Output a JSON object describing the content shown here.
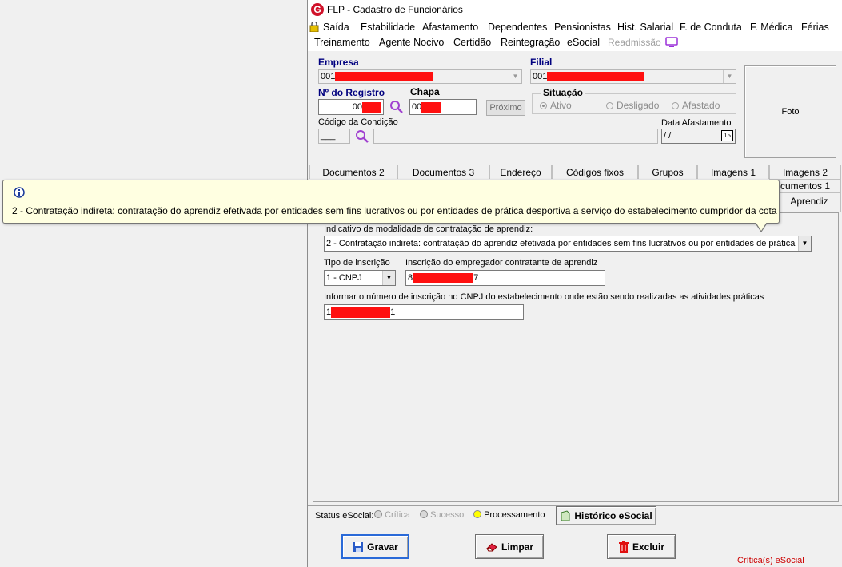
{
  "window": {
    "title": "FLP - Cadastro de Funcionários",
    "logo_letter": "G"
  },
  "menu": {
    "row1": [
      "Saída",
      "Estabilidade",
      "Afastamento",
      "Dependentes",
      "Pensionistas",
      "Hist. Salarial",
      "F. de Conduta",
      "F. Médica",
      "Férias"
    ],
    "row2": [
      "Treinamento",
      "Agente Nocivo",
      "Certidão",
      "Reintegração",
      "eSocial",
      "Readmissão"
    ]
  },
  "form": {
    "empresa_label": "Empresa",
    "empresa_value": "001",
    "filial_label": "Filial",
    "filial_value": "001",
    "registro_label": "Nº do Registro",
    "registro_value": "00",
    "chapa_label": "Chapa",
    "chapa_value": "00",
    "proximo_label": "Próximo",
    "situacao_label": "Situação",
    "situacao_options": [
      "Ativo",
      "Desligado",
      "Afastado"
    ],
    "codigo_condicao_label": "Código da Condição",
    "codigo_condicao_value": "___",
    "data_afastamento_label": "Data Afastamento",
    "data_afastamento_value": " /  /",
    "calendar_label": "15",
    "foto_label": "Foto"
  },
  "tabs": {
    "row1": [
      "Documentos 2",
      "Documentos 3",
      "Endereço",
      "Códigos fixos",
      "Grupos",
      "Imagens 1",
      "Imagens 2"
    ],
    "row2_partial": "cumentos 1",
    "active": "Aprendiz"
  },
  "aprendiz": {
    "modalidade_label": "Indicativo de modalidade de contratação de aprendiz:",
    "modalidade_value": "2 - Contratação indireta: contratação do aprendiz efetivada por entidades sem fins lucrativos ou por entidades de prática desp",
    "tipo_inscricao_label": "Tipo de inscrição",
    "tipo_inscricao_value": "1 - CNPJ",
    "inscricao_empregador_label": "Inscrição do empregador contratante de aprendiz",
    "inscricao_empregador_prefix": "8",
    "inscricao_empregador_suffix": "7",
    "cnpj_estab_label": "Informar o número de inscrição no CNPJ do estabelecimento onde estão sendo realizadas as atividades práticas",
    "cnpj_estab_prefix": "1",
    "cnpj_estab_suffix": "1"
  },
  "tooltip": {
    "icon": "info-icon",
    "text": "2 - Contratação indireta: contratação do aprendiz efetivada por entidades sem fins lucrativos ou por entidades de prática desportiva a serviço do estabelecimento cumpridor da cota"
  },
  "status": {
    "label": "Status eSocial:",
    "critica": "Crítica",
    "sucesso": "Sucesso",
    "processamento": "Processamento",
    "historico_button": "Histórico eSocial"
  },
  "actions": {
    "gravar": "Gravar",
    "limpar": "Limpar",
    "excluir": "Excluir",
    "criticas_link": "Crítica(s) eSocial"
  },
  "colors": {
    "label_blue": "#00007f",
    "redact": "#ff1010",
    "tooltip_bg": "#ffffe1",
    "processamento": "#ffff00",
    "link_red": "#cc0000"
  }
}
